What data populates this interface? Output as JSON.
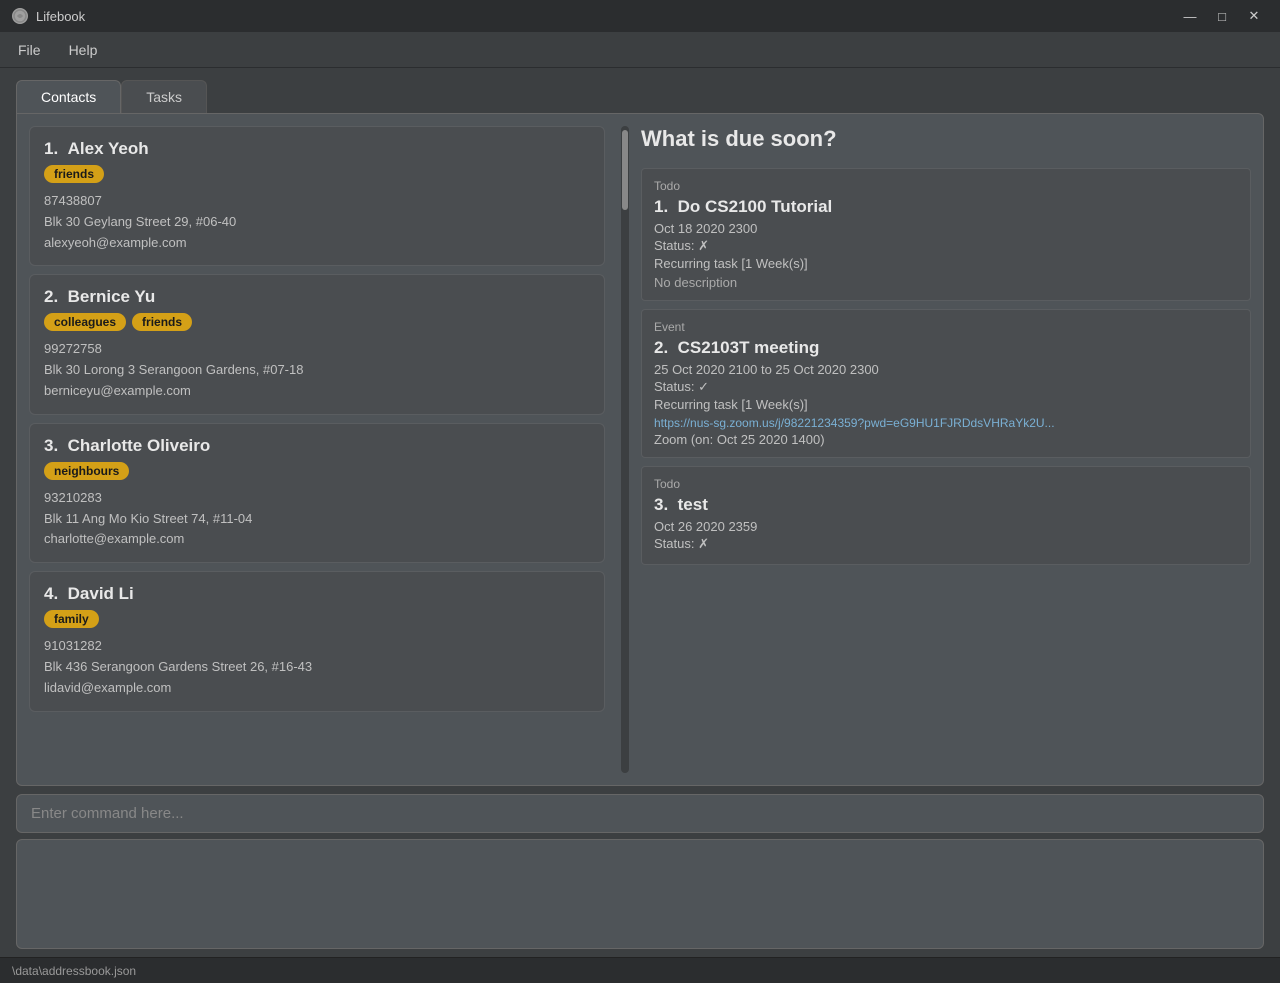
{
  "app": {
    "title": "Lifebook",
    "icon": "L"
  },
  "titlebar": {
    "minimize": "—",
    "maximize": "□",
    "close": "✕"
  },
  "menubar": {
    "items": [
      "File",
      "Help"
    ]
  },
  "tabs": [
    {
      "label": "Contacts",
      "active": true
    },
    {
      "label": "Tasks",
      "active": false
    }
  ],
  "contacts": [
    {
      "index": "1.",
      "name": "Alex Yeoh",
      "tags": [
        "friends"
      ],
      "phone": "87438807",
      "address": "Blk 30 Geylang Street 29, #06-40",
      "email": "alexyeoh@example.com"
    },
    {
      "index": "2.",
      "name": "Bernice Yu",
      "tags": [
        "colleagues",
        "friends"
      ],
      "phone": "99272758",
      "address": "Blk 30 Lorong 3 Serangoon Gardens, #07-18",
      "email": "berniceyu@example.com"
    },
    {
      "index": "3.",
      "name": "Charlotte Oliveiro",
      "tags": [
        "neighbours"
      ],
      "phone": "93210283",
      "address": "Blk 11 Ang Mo Kio Street 74, #11-04",
      "email": "charlotte@example.com"
    },
    {
      "index": "4.",
      "name": "David Li",
      "tags": [
        "family"
      ],
      "phone": "91031282",
      "address": "Blk 436 Serangoon Gardens Street 26, #16-43",
      "email": "lidavid@example.com"
    }
  ],
  "tasks_header": "What is due soon?",
  "tasks": [
    {
      "type": "Todo",
      "index": "1.",
      "title": "Do CS2100 Tutorial",
      "datetime": "Oct 18 2020 2300",
      "status": "Status:  ✗",
      "recurring": "Recurring task [1 Week(s)]",
      "description": "No description",
      "link": "",
      "zoom": ""
    },
    {
      "type": "Event",
      "index": "2.",
      "title": "CS2103T meeting",
      "datetime": "25 Oct 2020 2100 to 25 Oct 2020 2300",
      "status": "Status:  ✓",
      "recurring": "Recurring task [1 Week(s)]",
      "description": "",
      "link": "https://nus-sg.zoom.us/j/98221234359?pwd=eG9HU1FJRDdsVHRaYk2U...",
      "zoom": "Zoom (on: Oct 25 2020 1400)"
    },
    {
      "type": "Todo",
      "index": "3.",
      "title": "test",
      "datetime": "Oct 26 2020 2359",
      "status": "Status:  ✗",
      "recurring": "",
      "description": "",
      "link": "",
      "zoom": ""
    }
  ],
  "command": {
    "placeholder": "Enter command here..."
  },
  "statusbar": {
    "path": "\\data\\addressbook.json"
  }
}
